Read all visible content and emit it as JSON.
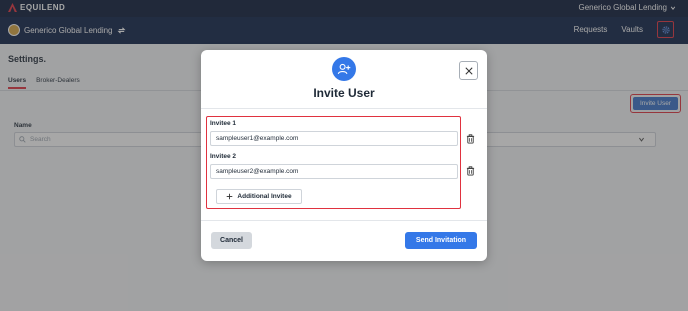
{
  "brand": {
    "name": "EQUILEND"
  },
  "topbar": {
    "org_switcher": "Generico Global Lending"
  },
  "navbar": {
    "org_name": "Generico Global Lending",
    "links": [
      "Requests",
      "Vaults"
    ]
  },
  "page": {
    "title": "Settings.",
    "tabs": [
      {
        "label": "Users",
        "active": true
      },
      {
        "label": "Broker-Dealers",
        "active": false
      }
    ],
    "invite_button": "Invite User",
    "name_label": "Name",
    "search_placeholder": "Search"
  },
  "modal": {
    "title": "Invite User",
    "invitees": [
      {
        "label": "Invitee 1",
        "value": "sampleuser1@example.com"
      },
      {
        "label": "Invitee 2",
        "value": "sampleuser2@example.com"
      }
    ],
    "add_label": "Additional Invitee",
    "cancel_label": "Cancel",
    "send_label": "Send Invitation"
  },
  "icons": {
    "logo": "triangle-logo-icon",
    "org_switch": "chevron-down-icon",
    "org_swap": "swap-icon",
    "settings": "gear-icon",
    "invite_user": "user-plus-icon",
    "close": "close-icon",
    "trash": "trash-icon",
    "add": "plus-icon",
    "search": "search-icon"
  },
  "colors": {
    "primary": "#3478e8",
    "highlight": "#e0323f",
    "nav_dark": "#0b1a3a",
    "nav": "#0e2147"
  }
}
